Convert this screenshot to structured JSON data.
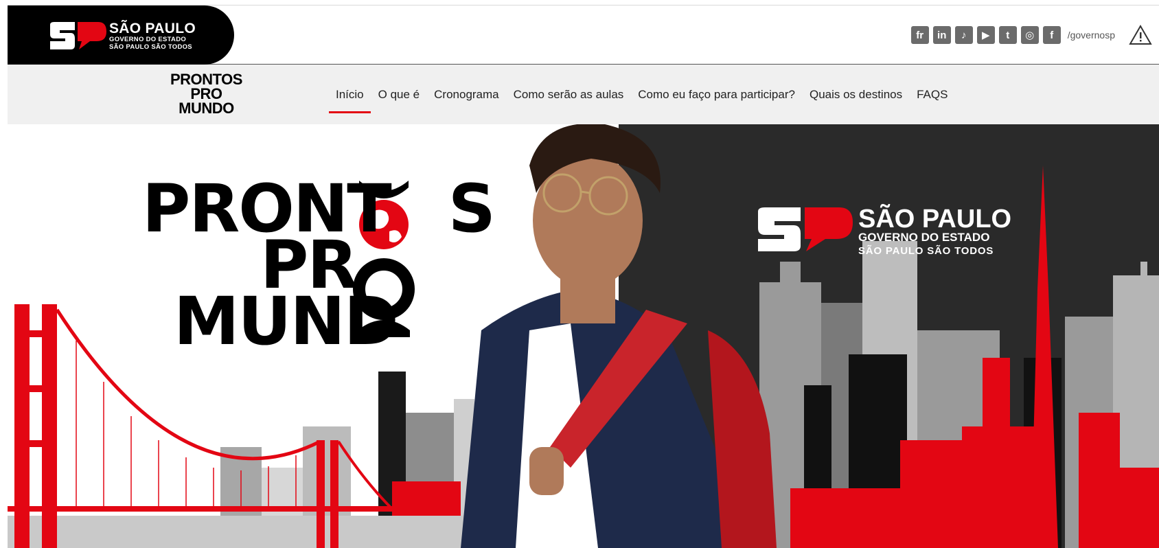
{
  "gov_header": {
    "title": "SÃO PAULO",
    "subtitle": "GOVERNO DO ESTADO",
    "tagline": "SÃO PAULO SÃO TODOS"
  },
  "social": {
    "icons": [
      "flickr-icon",
      "linkedin-icon",
      "tiktok-icon",
      "youtube-icon",
      "twitter-icon",
      "instagram-icon",
      "facebook-icon"
    ],
    "labels": [
      "fr",
      "in",
      "♪",
      "▶",
      "t",
      "◎",
      "f"
    ],
    "handle": "/governosp"
  },
  "nav": {
    "logo_lines": [
      "PRONTOS",
      "PRO",
      "MUNDO"
    ],
    "items": [
      "Início",
      "O que é",
      "Cronograma",
      "Como serão as aulas",
      "Como eu faço para participar?",
      "Quais os destinos",
      "FAQS"
    ],
    "active_index": 0
  },
  "hero": {
    "logo_lines": [
      "PRONT",
      "S",
      "PR",
      "MUND"
    ],
    "gov_title": "SÃO PAULO",
    "gov_subtitle": "GOVERNO DO ESTADO",
    "gov_tagline": "SÃO PAULO SÃO TODOS"
  },
  "colors": {
    "brand_red": "#e30613",
    "dark_bg": "#2a2a2a",
    "nav_bg": "#f0f0f0",
    "icon_gray": "#6b6b6b"
  }
}
